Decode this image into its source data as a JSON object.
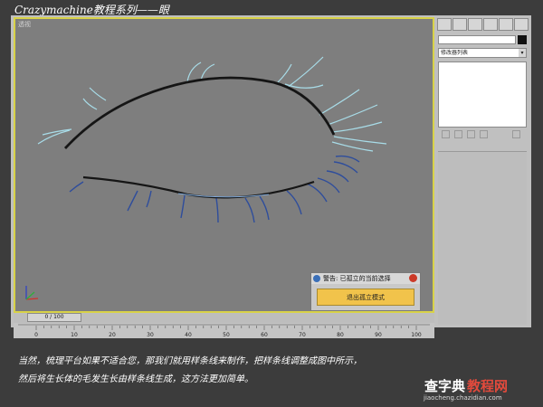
{
  "title": "Crazymachine教程系列——眼",
  "viewport": {
    "label": "透视"
  },
  "warning": {
    "title": "警告: 已孤立的当前选择",
    "button_label": "退出孤立模式"
  },
  "command_panel": {
    "modifier_list_label": "修改器列表"
  },
  "timeline": {
    "slider_text": "0 / 100",
    "ticks": [
      "0",
      "10",
      "20",
      "30",
      "40",
      "50",
      "60",
      "70",
      "80",
      "90",
      "100"
    ]
  },
  "caption": {
    "line1": "当然，梳理平台如果不适合您，那我们就用样条线来制作，把样条线调整成图中所示，",
    "line2": "然后将生长体的毛发生长由样条线生成，这方法更加简单。"
  },
  "watermark": {
    "logo_main": "查字典",
    "logo_accent": "教程网",
    "url": "jiaocheng.chazidian.com"
  },
  "colors": {
    "viewport_border": "#d8d248",
    "upper_lashes": "#a8dce8",
    "lower_lashes": "#2e4d9c",
    "lid_line": "#151515",
    "button": "#f1c34b"
  }
}
